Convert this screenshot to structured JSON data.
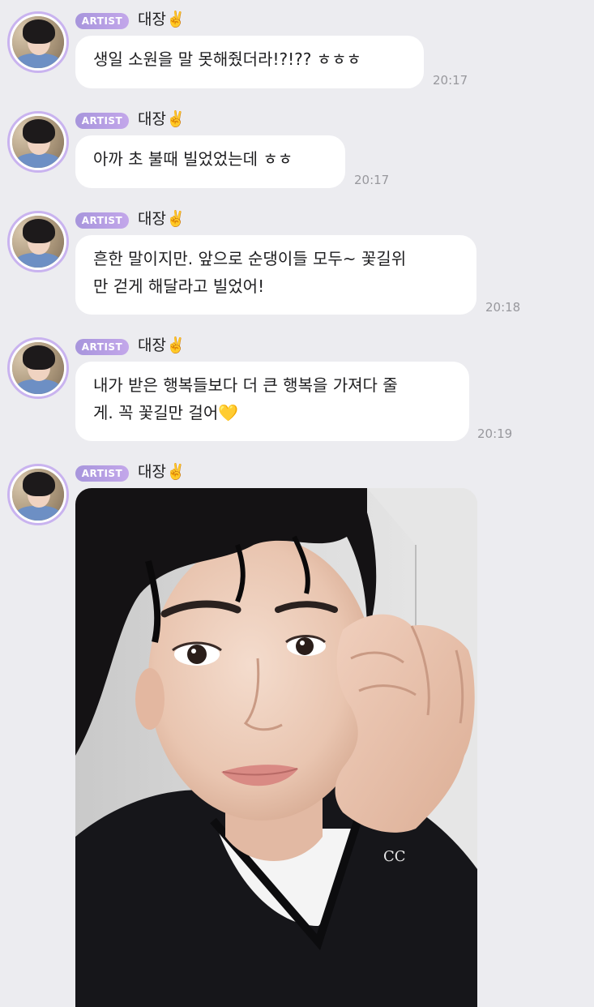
{
  "messages": [
    {
      "badge": "ARTIST",
      "sender": "대장",
      "sender_emoji": "✌️",
      "lines": [
        "생일 소원을 말 못해줬더라!?!?? ㅎㅎㅎ"
      ],
      "time": "20:17"
    },
    {
      "badge": "ARTIST",
      "sender": "대장",
      "sender_emoji": "✌️",
      "lines": [
        "아까 초 불때 빌었었는데 ㅎㅎ"
      ],
      "time": "20:17"
    },
    {
      "badge": "ARTIST",
      "sender": "대장",
      "sender_emoji": "✌️",
      "lines": [
        "흔한 말이지만. 앞으로 순댕이들 모두~ 꽃길위",
        "만 걷게 해달라고 빌었어!"
      ],
      "time": "20:18"
    },
    {
      "badge": "ARTIST",
      "sender": "대장",
      "sender_emoji": "✌️",
      "lines": [
        "내가 받은 행복들보다 더 큰 행복을 가져다 줄",
        "게. 꼭 꽃길만 걸어💛"
      ],
      "time": "20:19"
    },
    {
      "badge": "ARTIST",
      "sender": "대장",
      "sender_emoji": "✌️"
    }
  ],
  "colors": {
    "background": "#ececf0",
    "bubble": "#ffffff",
    "badge_gradient_start": "#a795dc",
    "badge_gradient_end": "#c3a7ea",
    "avatar_ring": "#c9b3ef",
    "timestamp": "#98989d",
    "text": "#1d1d1f"
  }
}
